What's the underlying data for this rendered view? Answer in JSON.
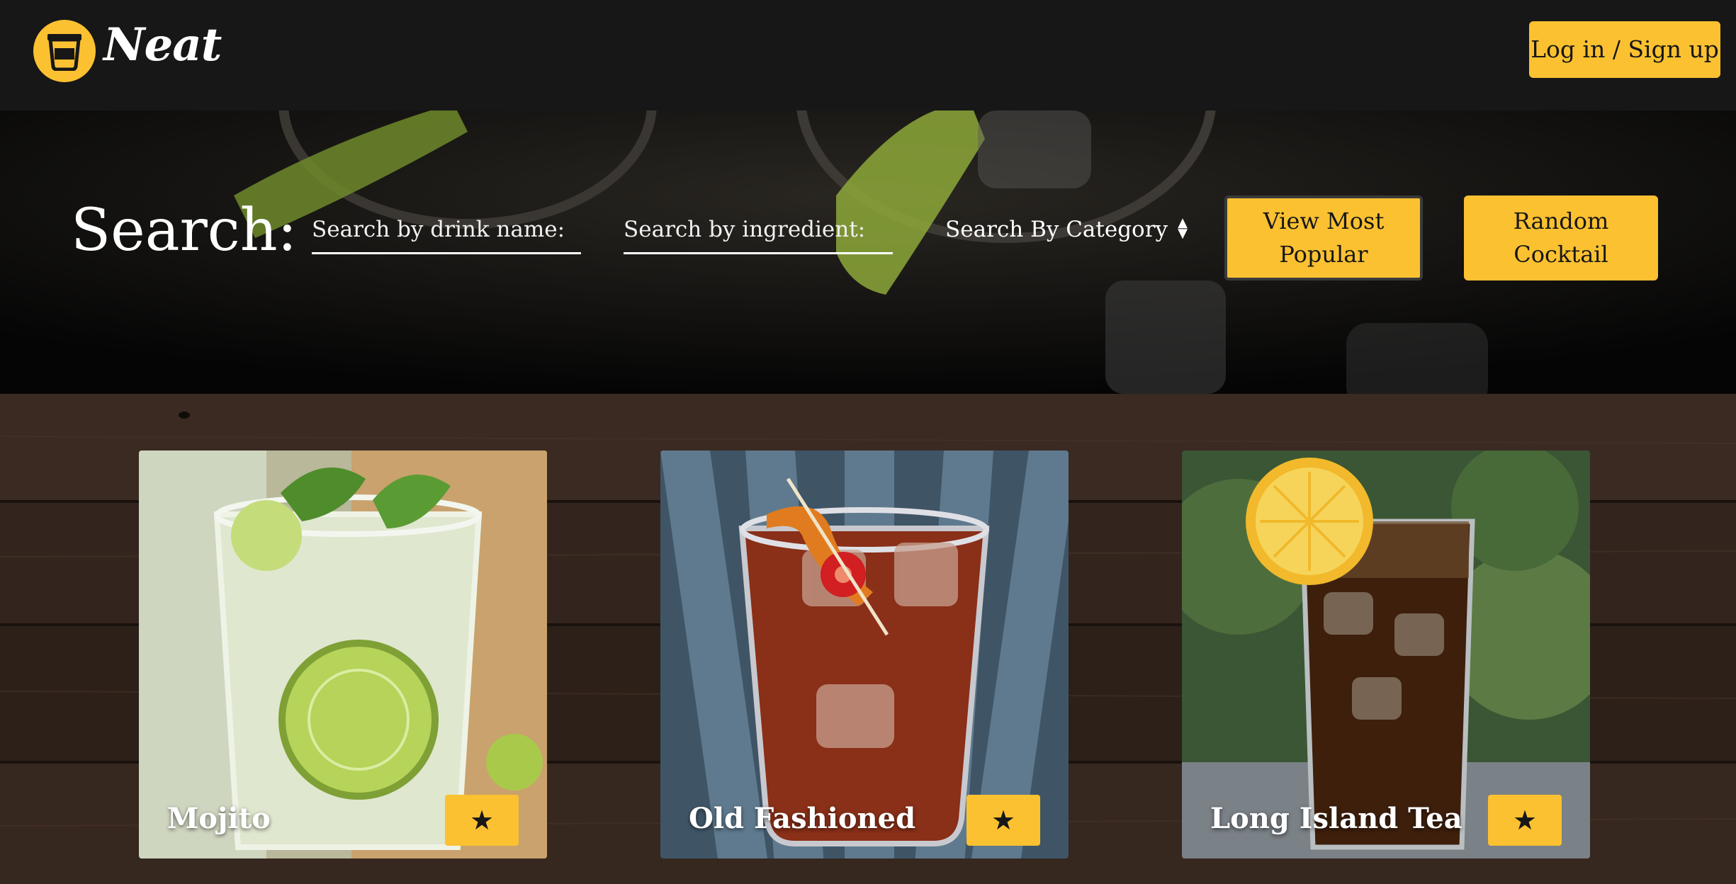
{
  "header": {
    "logo_text": "Neat",
    "login_label": "Log in / Sign up"
  },
  "search": {
    "title": "Search:",
    "drink_name_placeholder": "Search by drink name:",
    "ingredient_placeholder": "Search by ingredient:",
    "category_label": "Search By Category",
    "popular_line1": "View Most",
    "popular_line2": "Popular",
    "random_line1": "Random",
    "random_line2": "Cocktail"
  },
  "cocktails": [
    {
      "name": "Mojito",
      "favorite_icon": "★"
    },
    {
      "name": "Old Fashioned",
      "favorite_icon": "★"
    },
    {
      "name": "Long Island Tea",
      "favorite_icon": "★"
    }
  ],
  "colors": {
    "accent": "#fbc131",
    "header_bg": "#171717"
  }
}
